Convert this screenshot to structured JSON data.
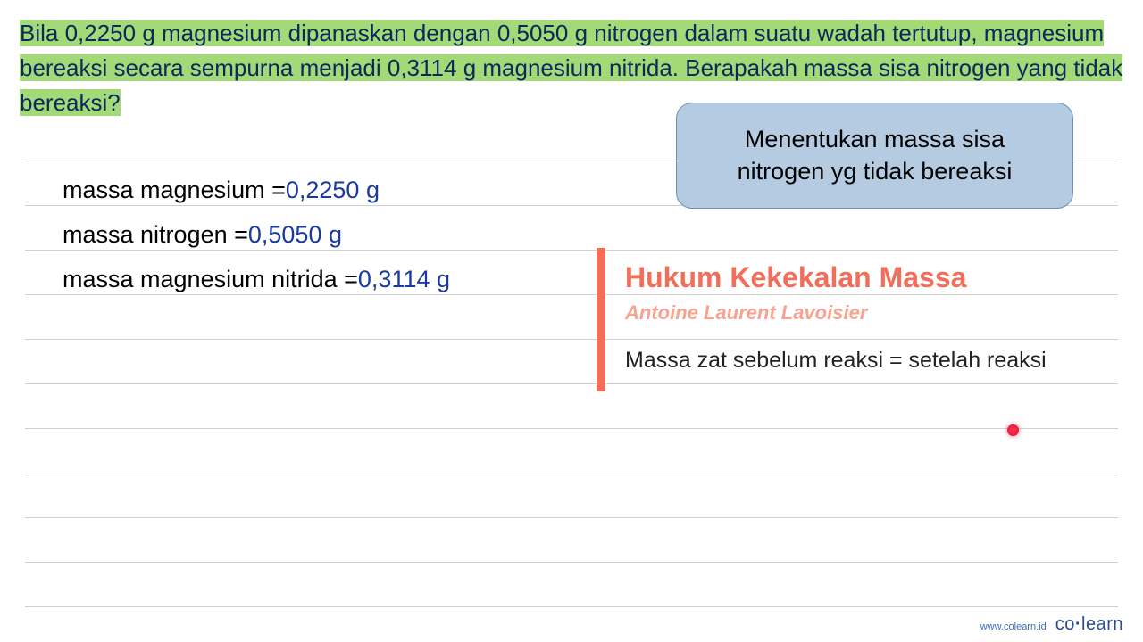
{
  "question": {
    "text": "Bila 0,2250 g magnesium dipanaskan dengan 0,5050 g nitrogen dalam suatu wadah tertutup, magnesium bereaksi secara sempurna menjadi 0,3114 g magnesium nitrida. Berapakah massa sisa nitrogen yang tidak bereaksi?"
  },
  "given": [
    {
      "label": "massa magnesium = ",
      "value": "0,2250 g"
    },
    {
      "label": "massa nitrogen = ",
      "value": "0,5050 g"
    },
    {
      "label": "massa magnesium nitrida = ",
      "value": "0,3114 g"
    }
  ],
  "callout": {
    "line1": "Menentukan massa sisa",
    "line2": "nitrogen yg tidak bereaksi"
  },
  "law": {
    "title": "Hukum Kekekalan Massa",
    "author": "Antoine Laurent Lavoisier",
    "statement": "Massa zat sebelum reaksi = setelah reaksi"
  },
  "footer": {
    "url": "www.colearn.id",
    "brand_part1": "co",
    "brand_dot": "·",
    "brand_part2": "learn"
  }
}
